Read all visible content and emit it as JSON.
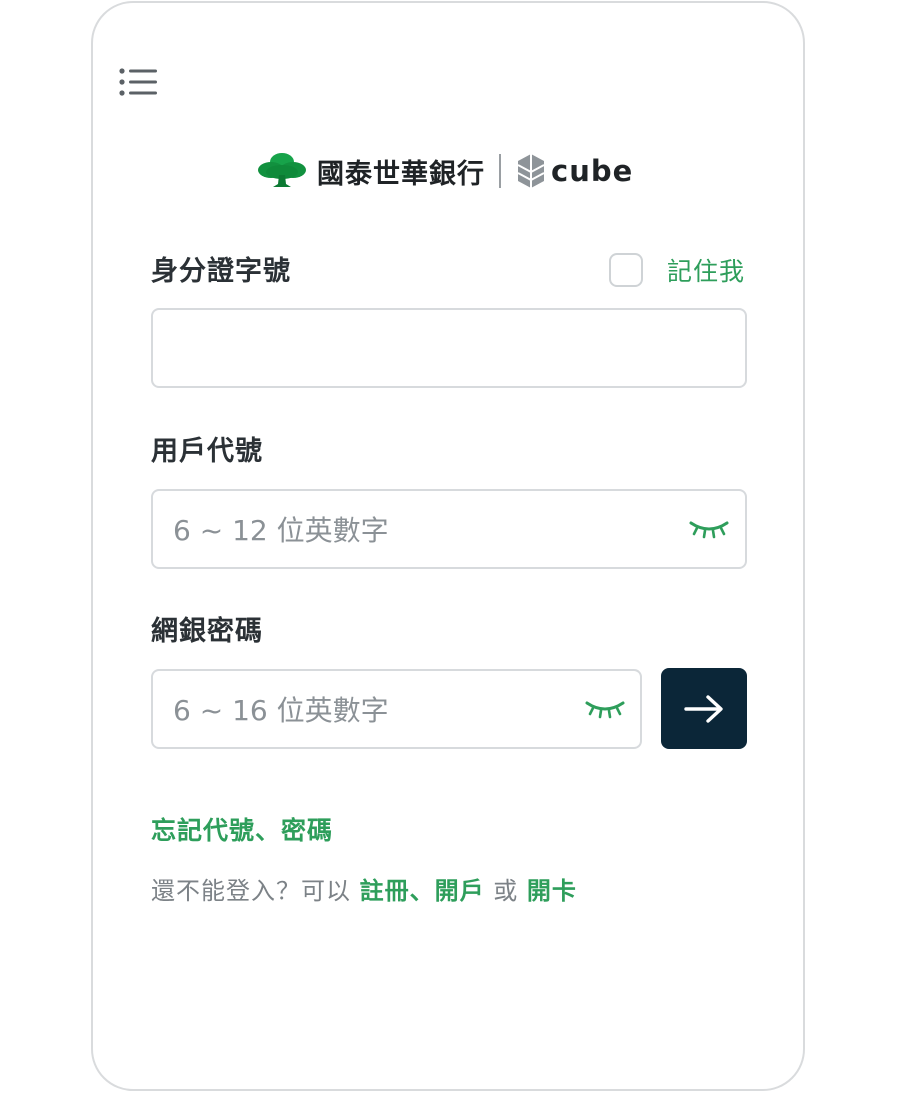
{
  "brand": {
    "bank_name": "國泰世華銀行",
    "app_name": "cube",
    "icons": {
      "menu": "menu-icon",
      "tree_logo": "tree-logo-icon",
      "cube_logo": "cube-logo-icon",
      "eye_closed": "eye-closed-icon",
      "arrow_right": "arrow-right-icon"
    },
    "colors": {
      "accent_green": "#2e9e5b",
      "button_dark": "#0b2638",
      "text_dark": "#2b3136",
      "placeholder_gray": "#8b9196"
    }
  },
  "form": {
    "id_label": "身分證字號",
    "remember_label": "記住我",
    "id_value": "",
    "user_label": "用戶代號",
    "user_placeholder": "6 ~ 12 位英數字",
    "password_label": "網銀密碼",
    "password_placeholder": "6 ~ 16 位英數字"
  },
  "links": {
    "forgot": "忘記代號、密碼",
    "help_prefix": "還不能登入？可以 ",
    "register": "註冊",
    "sep1": "、",
    "open_account": "開戶",
    "or": " 或 ",
    "apply_card": "開卡"
  }
}
